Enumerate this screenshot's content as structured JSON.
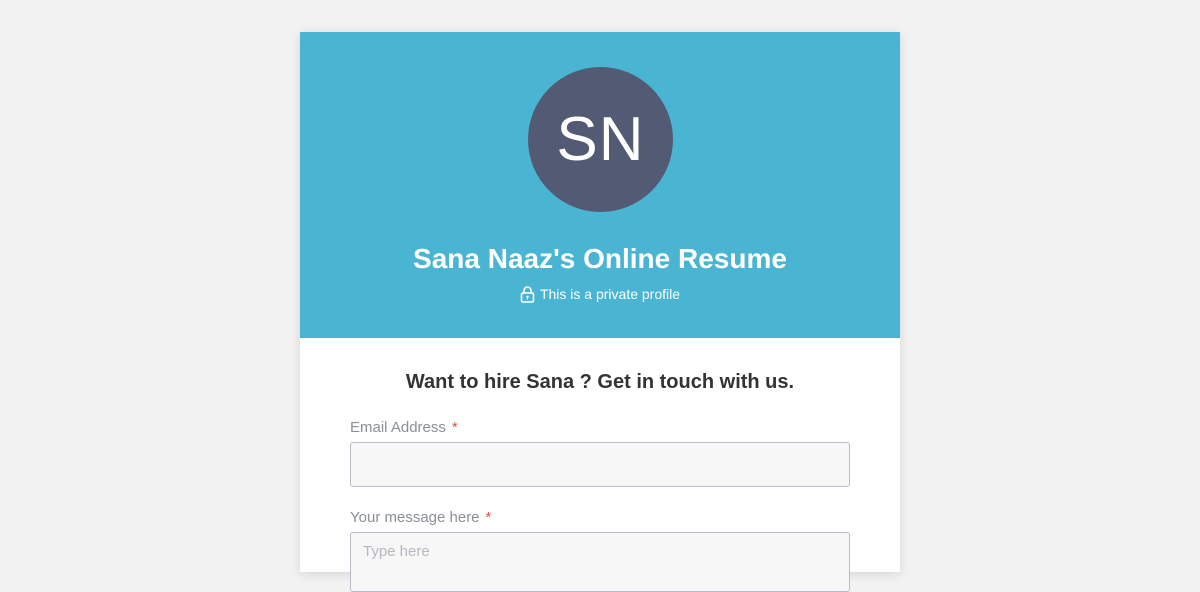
{
  "profile": {
    "initials": "SN",
    "title": "Sana Naaz's Online Resume",
    "privacy_text": "This is a private profile",
    "privacy_icon": "lock-icon"
  },
  "contact": {
    "heading": "Want to hire Sana ? Get in touch with us.",
    "email_label": "Email Address",
    "email_value": "",
    "message_label": "Your message here",
    "message_placeholder": "Type here",
    "required_marker": "*"
  },
  "colors": {
    "hero_background": "#4ab4d3",
    "avatar_background": "#525a74",
    "page_background": "#f2f2f2",
    "required": "#d9534f"
  }
}
